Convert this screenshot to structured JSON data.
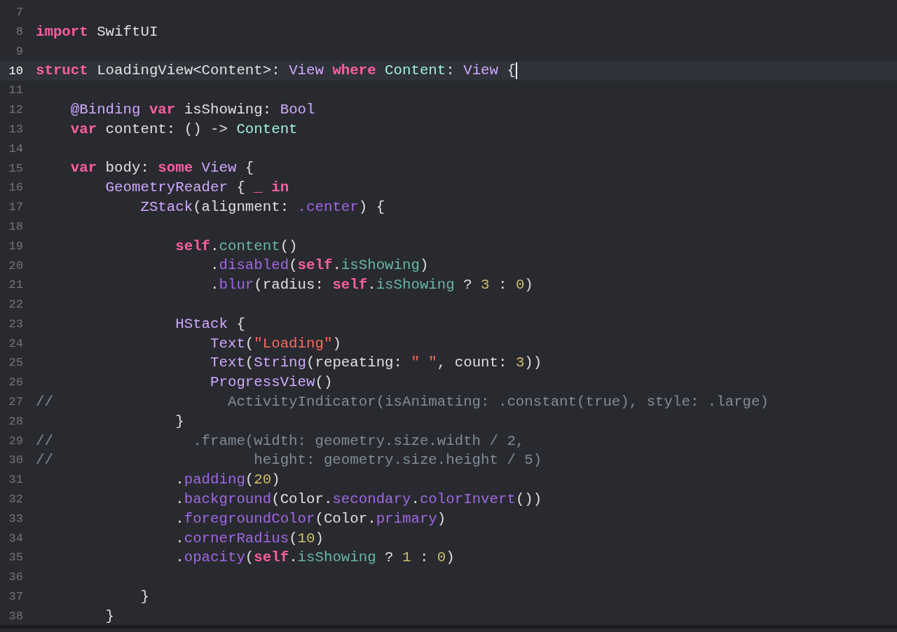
{
  "editor": {
    "lines": [
      {
        "number": "7",
        "current": false
      },
      {
        "number": "8",
        "current": false,
        "tokens": [
          {
            "kind": "keyword",
            "text": "import"
          },
          {
            "kind": "plain",
            "text": " SwiftUI"
          }
        ]
      },
      {
        "number": "9",
        "current": false
      },
      {
        "number": "10",
        "current": true,
        "tokens": [
          {
            "kind": "keyword",
            "text": "struct"
          },
          {
            "kind": "plain",
            "text": " LoadingView<Content>: "
          },
          {
            "kind": "type",
            "text": "View "
          },
          {
            "kind": "keyword",
            "text": "where "
          },
          {
            "kind": "project_type",
            "text": "Content"
          },
          {
            "kind": "plain",
            "text": ": "
          },
          {
            "kind": "type",
            "text": "View"
          },
          {
            "kind": "plain",
            "text": " {"
          }
        ]
      },
      {
        "number": "11",
        "current": false
      },
      {
        "number": "12",
        "current": false,
        "tokens": [
          {
            "kind": "attribute",
            "text": "    @Binding "
          },
          {
            "kind": "keyword",
            "text": "var"
          },
          {
            "kind": "plain",
            "text": " isShowing: "
          },
          {
            "kind": "type",
            "text": "Bool"
          }
        ]
      },
      {
        "number": "13",
        "current": false,
        "tokens": [
          {
            "kind": "keyword",
            "text": "    var"
          },
          {
            "kind": "plain",
            "text": " content: () -> "
          },
          {
            "kind": "project_type",
            "text": "Content"
          }
        ]
      },
      {
        "number": "14",
        "current": false
      },
      {
        "number": "15",
        "current": false,
        "tokens": [
          {
            "kind": "keyword",
            "text": "    var"
          },
          {
            "kind": "plain",
            "text": " body: "
          },
          {
            "kind": "keyword",
            "text": "some "
          },
          {
            "kind": "type",
            "text": "View"
          },
          {
            "kind": "plain",
            "text": " {"
          }
        ]
      },
      {
        "number": "16",
        "current": false,
        "tokens": [
          {
            "kind": "type",
            "text": "        GeometryReader"
          },
          {
            "kind": "plain",
            "text": " { "
          },
          {
            "kind": "keyword",
            "text": "_ in"
          }
        ]
      },
      {
        "number": "17",
        "current": false,
        "tokens": [
          {
            "kind": "type",
            "text": "            ZStack"
          },
          {
            "kind": "plain",
            "text": "(alignment: "
          },
          {
            "kind": "member",
            "text": ".center"
          },
          {
            "kind": "plain",
            "text": ") {"
          }
        ]
      },
      {
        "number": "18",
        "current": false
      },
      {
        "number": "19",
        "current": false,
        "tokens": [
          {
            "kind": "keyword",
            "text": "                self"
          },
          {
            "kind": "plain",
            "text": "."
          },
          {
            "kind": "project_member",
            "text": "content"
          },
          {
            "kind": "plain",
            "text": "()"
          }
        ]
      },
      {
        "number": "20",
        "current": false,
        "tokens": [
          {
            "kind": "plain",
            "text": "                    ."
          },
          {
            "kind": "member",
            "text": "disabled"
          },
          {
            "kind": "plain",
            "text": "("
          },
          {
            "kind": "keyword",
            "text": "self"
          },
          {
            "kind": "plain",
            "text": "."
          },
          {
            "kind": "project_member",
            "text": "isShowing"
          },
          {
            "kind": "plain",
            "text": ")"
          }
        ]
      },
      {
        "number": "21",
        "current": false,
        "tokens": [
          {
            "kind": "plain",
            "text": "                    ."
          },
          {
            "kind": "member",
            "text": "blur"
          },
          {
            "kind": "plain",
            "text": "(radius: "
          },
          {
            "kind": "keyword",
            "text": "self"
          },
          {
            "kind": "plain",
            "text": "."
          },
          {
            "kind": "project_member",
            "text": "isShowing"
          },
          {
            "kind": "plain",
            "text": " ? "
          },
          {
            "kind": "number",
            "text": "3"
          },
          {
            "kind": "plain",
            "text": " : "
          },
          {
            "kind": "number",
            "text": "0"
          },
          {
            "kind": "plain",
            "text": ")"
          }
        ]
      },
      {
        "number": "22",
        "current": false
      },
      {
        "number": "23",
        "current": false,
        "tokens": [
          {
            "kind": "type",
            "text": "                HStack"
          },
          {
            "kind": "plain",
            "text": " {"
          }
        ]
      },
      {
        "number": "24",
        "current": false,
        "tokens": [
          {
            "kind": "type",
            "text": "                    Text"
          },
          {
            "kind": "plain",
            "text": "("
          },
          {
            "kind": "string",
            "text": "\"Loading\""
          },
          {
            "kind": "plain",
            "text": ")"
          }
        ]
      },
      {
        "number": "25",
        "current": false,
        "tokens": [
          {
            "kind": "type",
            "text": "                    Text"
          },
          {
            "kind": "plain",
            "text": "("
          },
          {
            "kind": "type",
            "text": "String"
          },
          {
            "kind": "plain",
            "text": "(repeating: "
          },
          {
            "kind": "string",
            "text": "\" \""
          },
          {
            "kind": "plain",
            "text": ", count: "
          },
          {
            "kind": "number",
            "text": "3"
          },
          {
            "kind": "plain",
            "text": "))"
          }
        ]
      },
      {
        "number": "26",
        "current": false,
        "tokens": [
          {
            "kind": "type",
            "text": "                    ProgressView"
          },
          {
            "kind": "plain",
            "text": "()"
          }
        ]
      },
      {
        "number": "27",
        "current": false,
        "tokens": [
          {
            "kind": "comment",
            "text": "//                    ActivityIndicator(isAnimating: .constant(true), style: .large)"
          }
        ]
      },
      {
        "number": "28",
        "current": false,
        "tokens": [
          {
            "kind": "plain",
            "text": "                }"
          }
        ]
      },
      {
        "number": "29",
        "current": false,
        "tokens": [
          {
            "kind": "comment",
            "text": "//                .frame(width: geometry.size.width / 2,"
          }
        ]
      },
      {
        "number": "30",
        "current": false,
        "tokens": [
          {
            "kind": "comment",
            "text": "//                       height: geometry.size.height / 5)"
          }
        ]
      },
      {
        "number": "31",
        "current": false,
        "tokens": [
          {
            "kind": "plain",
            "text": "                ."
          },
          {
            "kind": "member",
            "text": "padding"
          },
          {
            "kind": "plain",
            "text": "("
          },
          {
            "kind": "number",
            "text": "20"
          },
          {
            "kind": "plain",
            "text": ")"
          }
        ]
      },
      {
        "number": "32",
        "current": false,
        "tokens": [
          {
            "kind": "plain",
            "text": "                ."
          },
          {
            "kind": "member",
            "text": "background"
          },
          {
            "kind": "plain",
            "text": "(Color."
          },
          {
            "kind": "member",
            "text": "secondary"
          },
          {
            "kind": "plain",
            "text": "."
          },
          {
            "kind": "member",
            "text": "colorInvert"
          },
          {
            "kind": "plain",
            "text": "())"
          }
        ]
      },
      {
        "number": "33",
        "current": false,
        "tokens": [
          {
            "kind": "plain",
            "text": "                ."
          },
          {
            "kind": "member",
            "text": "foregroundColor"
          },
          {
            "kind": "plain",
            "text": "(Color."
          },
          {
            "kind": "member",
            "text": "primary"
          },
          {
            "kind": "plain",
            "text": ")"
          }
        ]
      },
      {
        "number": "34",
        "current": false,
        "tokens": [
          {
            "kind": "plain",
            "text": "                ."
          },
          {
            "kind": "member",
            "text": "cornerRadius"
          },
          {
            "kind": "plain",
            "text": "("
          },
          {
            "kind": "number",
            "text": "10"
          },
          {
            "kind": "plain",
            "text": ")"
          }
        ]
      },
      {
        "number": "35",
        "current": false,
        "tokens": [
          {
            "kind": "plain",
            "text": "                ."
          },
          {
            "kind": "member",
            "text": "opacity"
          },
          {
            "kind": "plain",
            "text": "("
          },
          {
            "kind": "keyword",
            "text": "self"
          },
          {
            "kind": "plain",
            "text": "."
          },
          {
            "kind": "project_member",
            "text": "isShowing"
          },
          {
            "kind": "plain",
            "text": " ? "
          },
          {
            "kind": "number",
            "text": "1"
          },
          {
            "kind": "plain",
            "text": " : "
          },
          {
            "kind": "number",
            "text": "0"
          },
          {
            "kind": "plain",
            "text": ")"
          }
        ]
      },
      {
        "number": "36",
        "current": false
      },
      {
        "number": "37",
        "current": false,
        "tokens": [
          {
            "kind": "plain",
            "text": "            }"
          }
        ]
      },
      {
        "number": "38",
        "current": false,
        "tokens": [
          {
            "kind": "plain",
            "text": "        }"
          }
        ]
      }
    ]
  }
}
